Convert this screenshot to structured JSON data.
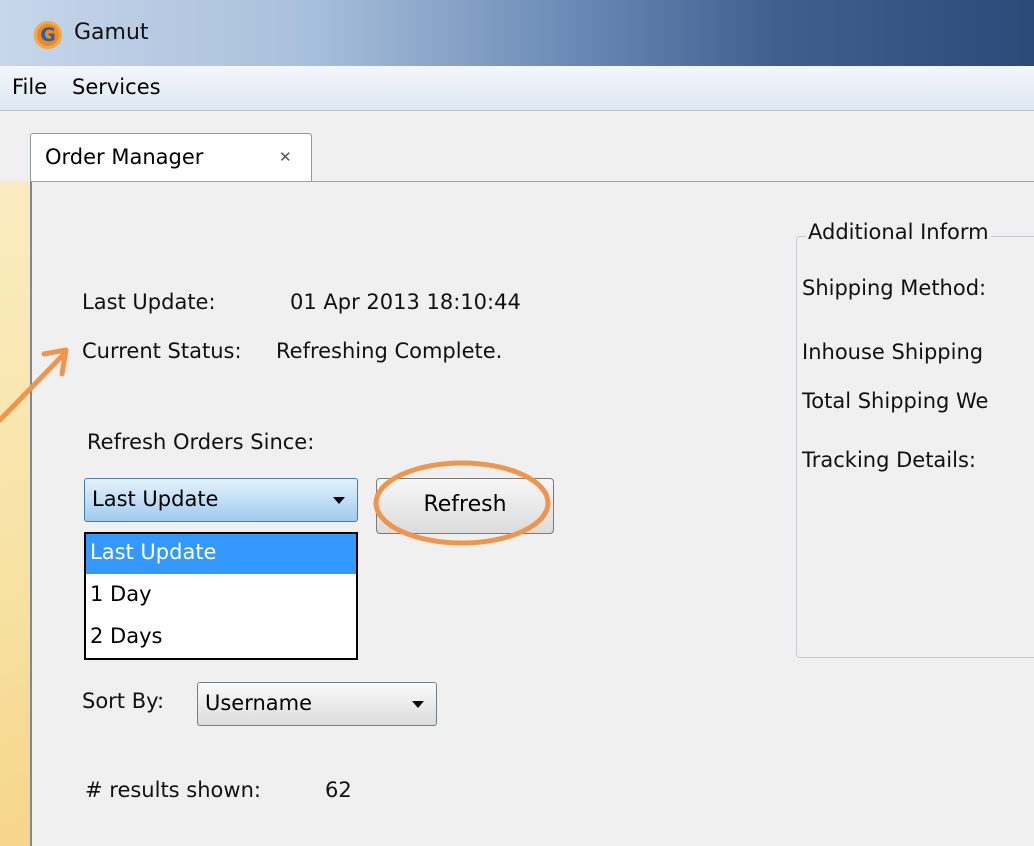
{
  "window": {
    "title": "Gamut",
    "icon": "gamut-app-icon"
  },
  "menu": {
    "items": [
      "File",
      "Services"
    ]
  },
  "tab": {
    "label": "Order Manager",
    "close_glyph": "✕"
  },
  "status": {
    "last_update_label": "Last Update:",
    "last_update_value": "01 Apr 2013 18:10:44",
    "current_status_label": "Current Status:",
    "current_status_value": "Refreshing Complete."
  },
  "refresh": {
    "since_label": "Refresh Orders Since:",
    "selected": "Last Update",
    "options": [
      "Last Update",
      "1 Day",
      "2 Days"
    ],
    "button_label": "Refresh"
  },
  "sort": {
    "label": "Sort By:",
    "selected": "Username"
  },
  "results": {
    "label": "# results shown:",
    "count": "62"
  },
  "additional_info": {
    "title": "Additional Inform",
    "fields": [
      "Shipping Method:",
      "Inhouse Shipping",
      "Total Shipping We",
      "Tracking Details:"
    ]
  },
  "colors": {
    "annotation": "#f0954b",
    "selection": "#3399ff"
  }
}
